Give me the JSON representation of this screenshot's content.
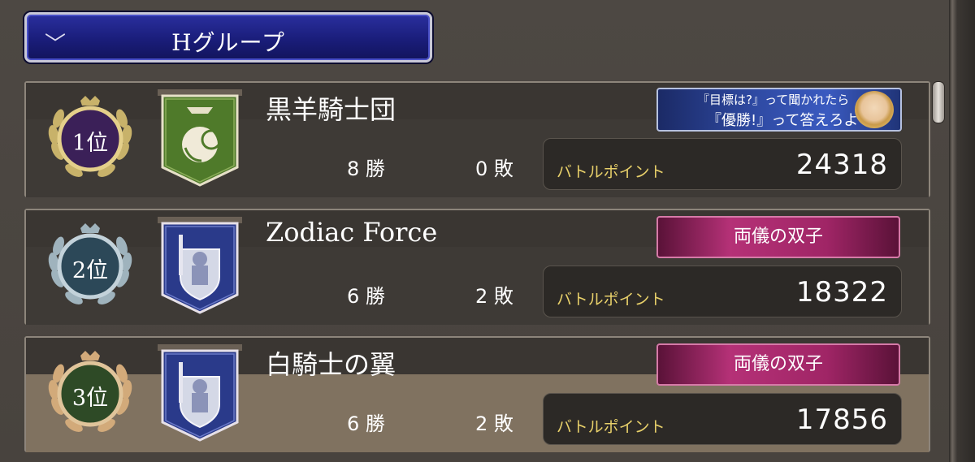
{
  "header": {
    "title": "Hグループ",
    "toggle_icon": "chevron-down-icon"
  },
  "rows": [
    {
      "rank": "1位",
      "rank_color": "#3a1f5a",
      "rank_ring": "#d9c27a",
      "name": "黒羊騎士団",
      "banner": {
        "color": "#4f7a2a",
        "emblem": "ram-emblem-icon"
      },
      "tag_line1": "『目標は?』って聞かれたら",
      "tag_line2": "『優勝!』って答えろよ",
      "wins": "8 勝",
      "losses": "0 敗",
      "bp_label": "バトルポイント",
      "bp_value": "24318"
    },
    {
      "rank": "2位",
      "rank_color": "#2c4a5a",
      "rank_ring": "#9fb6c4",
      "name": "Zodiac Force",
      "banner": {
        "color": "#2a3a8a",
        "emblem": "knight-shield-emblem-icon"
      },
      "tag": "両儀の双子",
      "wins": "6 勝",
      "losses": "2 敗",
      "bp_label": "バトルポイント",
      "bp_value": "18322"
    },
    {
      "rank": "3位",
      "rank_color": "#2c4a28",
      "rank_ring": "#c9a06a",
      "name": "白騎士の翼",
      "banner": {
        "color": "#2a3a8a",
        "emblem": "knight-shield-emblem-icon"
      },
      "tag": "両儀の双子",
      "wins": "6 勝",
      "losses": "2 敗",
      "bp_label": "バトルポイント",
      "bp_value": "17856"
    }
  ]
}
